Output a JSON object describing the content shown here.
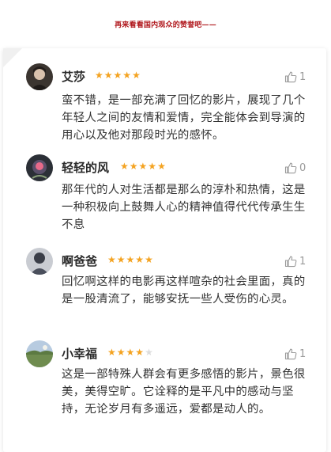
{
  "header": {
    "caption": "再来看看国内观众的赞誉吧——"
  },
  "colors": {
    "caption": "#b0171c",
    "star": "#f4a321",
    "star_empty": "#dcdcdc",
    "like": "#9a9a9a"
  },
  "reviews": [
    {
      "user": "艾莎",
      "rating": 5,
      "max_rating": 5,
      "likes": "1",
      "like_icon": "thumbs-up-icon",
      "text": "蛮不错，是一部充满了回忆的影片，展现了几个年轻人之间的友情和爱情，完全能体会到导演的用心以及他对那段时光的感怀。"
    },
    {
      "user": "轻轻的风",
      "rating": 5,
      "max_rating": 5,
      "likes": "0",
      "like_icon": "thumbs-up-icon",
      "text": "那年代的人对生活都是那么的淳朴和热情，这是一种积极向上鼓舞人心的精神值得代代传承生生不息"
    },
    {
      "user": "啊爸爸",
      "rating": 5,
      "max_rating": 5,
      "likes": "1",
      "like_icon": "thumbs-up-icon",
      "text": "回忆啊这样的电影再这样喧杂的社会里面，真的是一股清流了，能够安抚一些人受伤的心灵。"
    },
    {
      "user": "小幸福",
      "rating": 4,
      "max_rating": 5,
      "likes": "1",
      "like_icon": "thumbs-up-icon",
      "text": "这是一部特殊人群会有更多感悟的影片，景色很美，美得空旷。它诠释的是平凡中的感动与坚持，无论岁月有多遥远，爱都是动人的。"
    }
  ]
}
